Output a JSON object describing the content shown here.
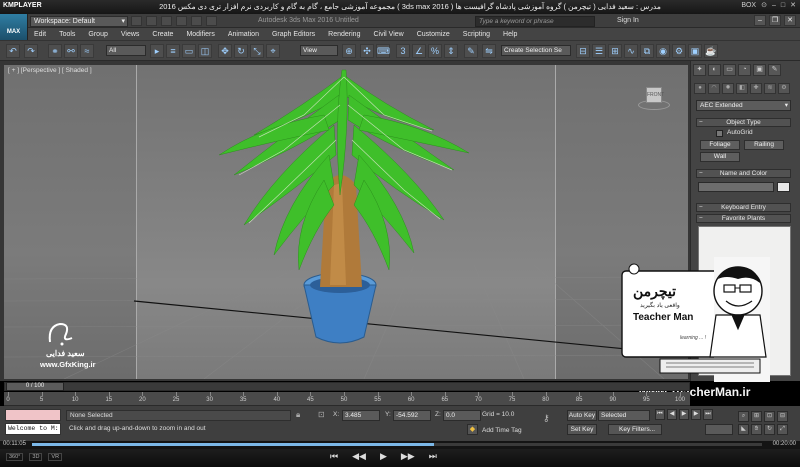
{
  "player": {
    "logo": "KMPLAYER",
    "title": "مجموعه آموزشی جامع ، گام به گام و کاربردی نرم افزار تری دی مکس 2016 ( 3ds max 2016 )  مدرس : سعید فدایی ( تیچرمن ) گروه آموزشی پادشاه گرافیست ها",
    "box_label": "BOX",
    "time_current": "00:11:05",
    "time_total": "00:20:00",
    "progress_fraction": 0.55,
    "controls": [
      "⏮",
      "◀◀",
      "▶",
      "▶▶",
      "⏭"
    ],
    "left_tags": [
      "360°",
      "3D",
      "VR"
    ]
  },
  "max": {
    "logo_label": "MAX",
    "workspace": "Workspace: Default",
    "app_title": "Autodesk 3ds Max 2016    Untitled",
    "search_placeholder": "Type a keyword or phrase",
    "sign_in": "Sign In",
    "menu": [
      "Edit",
      "Tools",
      "Group",
      "Views",
      "Create",
      "Modifiers",
      "Animation",
      "Graph Editors",
      "Rendering",
      "Civil View",
      "Customize",
      "Scripting",
      "Help"
    ],
    "toolbar": {
      "filter_dropdown": "All",
      "ref_coord_dropdown": "View",
      "selection_set_placeholder": "Create Selection Se",
      "snap_label": "3"
    },
    "viewport_label": "[ + ] [Perspective ] [ Shaded ]",
    "viewcube_label": "FRONT"
  },
  "command_panel": {
    "tabs": [
      "✦",
      "◐",
      "▭",
      "◔",
      "▣",
      "✎"
    ],
    "category_dropdown": "AEC Extended",
    "object_type": {
      "header": "Object Type",
      "autogrid_label": "AutoGrid",
      "buttons": [
        "Foliage",
        "Railing",
        "Wall"
      ]
    },
    "name_and_color_header": "Name and Color",
    "keyboard_entry_header": "Keyboard Entry",
    "favorite_plants_header": "Favorite Plants"
  },
  "branding": {
    "teacher_man_fa": "تیچرمن",
    "teacher_man_sub_fa": "واقعی یاد بگیرید",
    "teacher_man_en": "Teacher Man",
    "teacher_man_tag": "learning ... !",
    "url": "www.TeacherMan.ir",
    "watermark_name": "سعید فدایی",
    "watermark_site": "www.GfxKing.ir"
  },
  "timeline": {
    "thumb_label": "0 / 100",
    "ticks": [
      "0",
      "5",
      "10",
      "15",
      "20",
      "25",
      "30",
      "35",
      "40",
      "45",
      "50",
      "55",
      "60",
      "65",
      "70",
      "75",
      "80",
      "85",
      "90",
      "95",
      "100"
    ]
  },
  "status": {
    "welcome": "Welcome to M:",
    "selection": "None Selected",
    "prompt": "Click and drag up-and-down to zoom in and out",
    "x_label": "X:",
    "x_value": "3.485",
    "y_label": "Y:",
    "y_value": "-54.592",
    "z_label": "Z:",
    "z_value": "0.0",
    "grid": "Grid = 10.0",
    "add_time_tag": "Add Time Tag",
    "auto_key": "Auto Key",
    "set_key": "Set Key",
    "selected_dropdown": "Selected",
    "key_filters": "Key Filters..."
  },
  "colors": {
    "accent_blue": "#2f7ea3",
    "plant_green": "#3fbf2a",
    "pot_blue": "#3e7fc4",
    "trunk_brown": "#b07a3a"
  }
}
